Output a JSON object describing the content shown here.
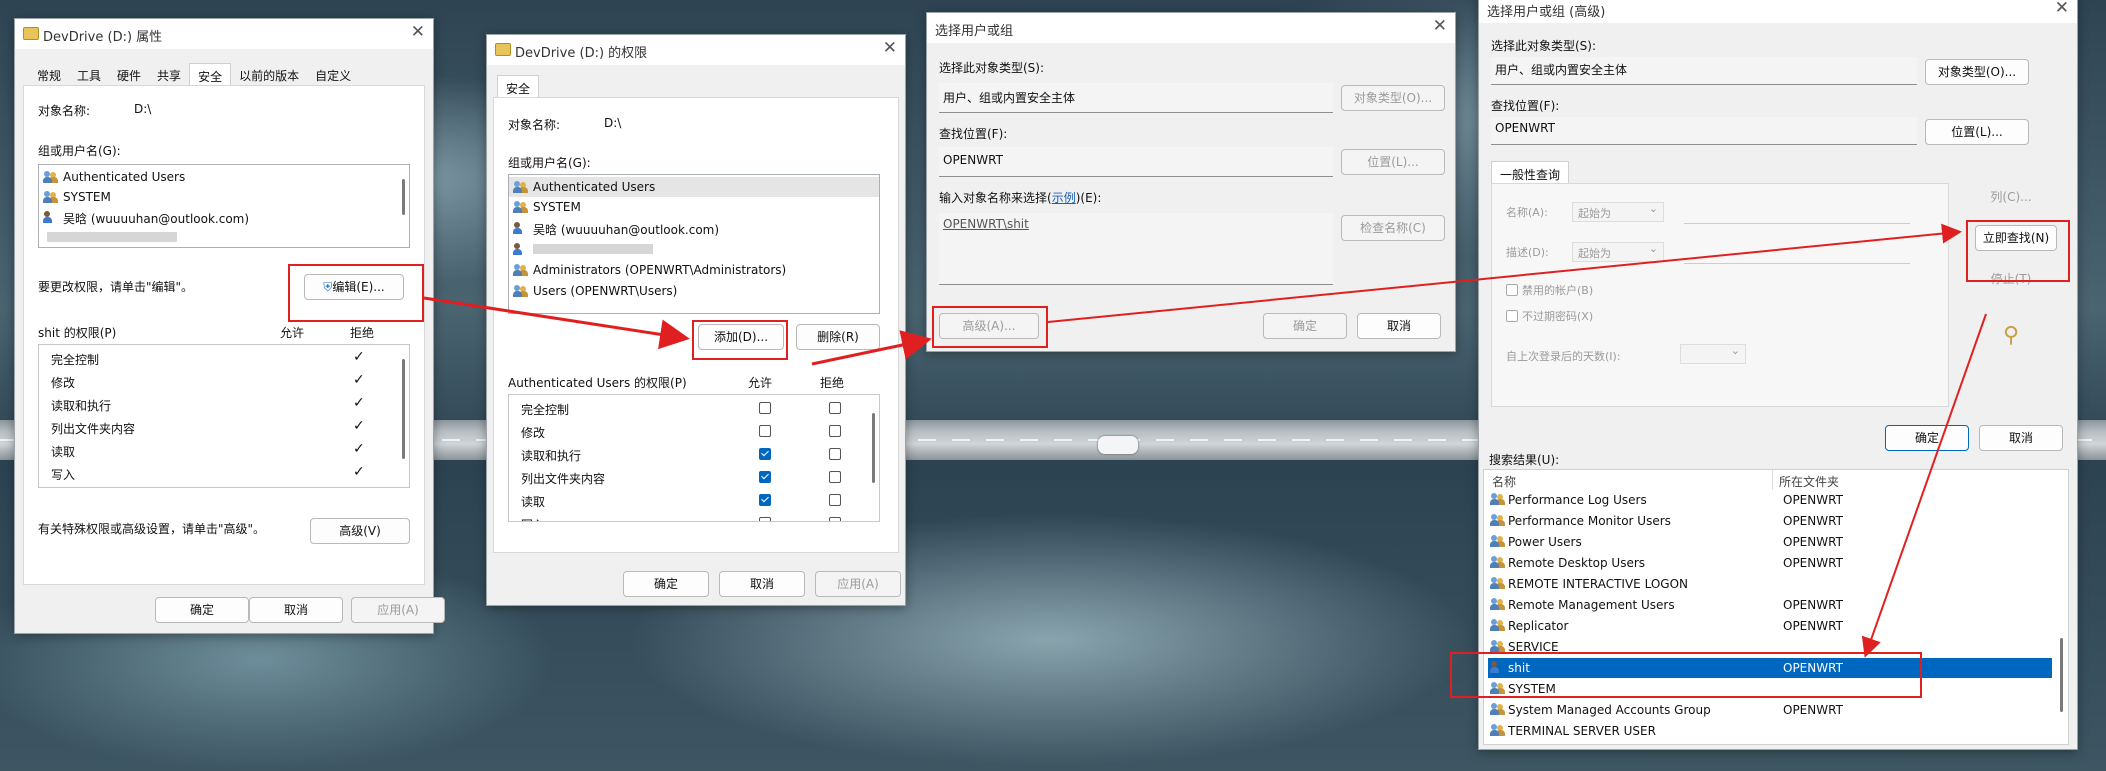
{
  "w1": {
    "title": "DevDrive (D:) 属性",
    "tabs": [
      "常规",
      "工具",
      "硬件",
      "共享",
      "安全",
      "以前的版本",
      "自定义"
    ],
    "object_name_label": "对象名称:",
    "object_name": "D:\\",
    "groups_label": "组或用户名(G):",
    "users": [
      "Authenticated Users",
      "SYSTEM",
      "吴晗 (wuuuuhan@outlook.com)"
    ],
    "hint": "要更改权限，请单击\"编辑\"。",
    "edit_btn": "编辑(E)...",
    "perm_label": "shit 的权限(P)",
    "allow": "允许",
    "deny": "拒绝",
    "perms": [
      "完全控制",
      "修改",
      "读取和执行",
      "列出文件夹内容",
      "读取",
      "写入"
    ],
    "adv_hint": "有关特殊权限或高级设置，请单击\"高级\"。",
    "adv_btn": "高级(V)",
    "ok": "确定",
    "cancel": "取消",
    "apply": "应用(A)"
  },
  "w2": {
    "title": "DevDrive (D:) 的权限",
    "tab": "安全",
    "object_name_label": "对象名称:",
    "object_name": "D:\\",
    "groups_label": "组或用户名(G):",
    "users": [
      "Authenticated Users",
      "SYSTEM",
      "吴晗 (wuuuuhan@outlook.com)",
      "",
      "Administrators (OPENWRT\\Administrators)",
      "Users (OPENWRT\\Users)"
    ],
    "add_btn": "添加(D)...",
    "remove_btn": "删除(R)",
    "perm_label": "Authenticated Users 的权限(P)",
    "allow": "允许",
    "deny": "拒绝",
    "perms": [
      "完全控制",
      "修改",
      "读取和执行",
      "列出文件夹内容",
      "读取",
      "写入"
    ],
    "allow_checked": [
      false,
      false,
      true,
      true,
      true,
      false
    ],
    "ok": "确定",
    "cancel": "取消",
    "apply": "应用(A)"
  },
  "w3": {
    "title": "选择用户或组",
    "type_label": "选择此对象类型(S):",
    "type_value": "用户、组或内置安全主体",
    "type_btn": "对象类型(O)...",
    "loc_label": "查找位置(F):",
    "loc_value": "OPENWRT",
    "loc_btn": "位置(L)...",
    "enter_label_a": "输入对象名称来选择(",
    "enter_link": "示例",
    "enter_label_b": ")(E):",
    "entered": "OPENWRT\\shit",
    "check_btn": "检查名称(C)",
    "adv_btn": "高级(A)...",
    "ok": "确定",
    "cancel": "取消"
  },
  "w4": {
    "title": "选择用户或组 (高级)",
    "type_label": "选择此对象类型(S):",
    "type_value": "用户、组或内置安全主体",
    "type_btn": "对象类型(O)...",
    "loc_label": "查找位置(F):",
    "loc_value": "OPENWRT",
    "loc_btn": "位置(L)...",
    "tab": "一般性查询",
    "name_label": "名称(A):",
    "desc_label": "描述(D):",
    "starts_with": "起始为",
    "disabled_label": "禁用的帐户(B)",
    "noexpire_label": "不过期密码(X)",
    "days_label": "自上次登录后的天数(I):",
    "columns_btn": "列(C)...",
    "find_btn": "立即查找(N)",
    "stop_btn": "停止(T)",
    "ok": "确定",
    "cancel": "取消",
    "results_label": "搜索结果(U):",
    "col_name": "名称",
    "col_folder": "所在文件夹",
    "results": [
      {
        "name": "Performance Log Users",
        "folder": "OPENWRT"
      },
      {
        "name": "Performance Monitor Users",
        "folder": "OPENWRT"
      },
      {
        "name": "Power Users",
        "folder": "OPENWRT"
      },
      {
        "name": "Remote Desktop Users",
        "folder": "OPENWRT"
      },
      {
        "name": "REMOTE INTERACTIVE LOGON",
        "folder": ""
      },
      {
        "name": "Remote Management Users",
        "folder": "OPENWRT"
      },
      {
        "name": "Replicator",
        "folder": "OPENWRT"
      },
      {
        "name": "SERVICE",
        "folder": ""
      },
      {
        "name": "shit",
        "folder": "OPENWRT"
      },
      {
        "name": "SYSTEM",
        "folder": ""
      },
      {
        "name": "System Managed Accounts Group",
        "folder": "OPENWRT"
      },
      {
        "name": "TERMINAL SERVER USER",
        "folder": ""
      }
    ]
  },
  "colors": {
    "accent": "#0067c0",
    "annotation": "#e02020"
  },
  "icons": [
    "folder-icon",
    "users-icon",
    "user-icon",
    "shield-icon",
    "search-people-icon",
    "close-icon"
  ]
}
